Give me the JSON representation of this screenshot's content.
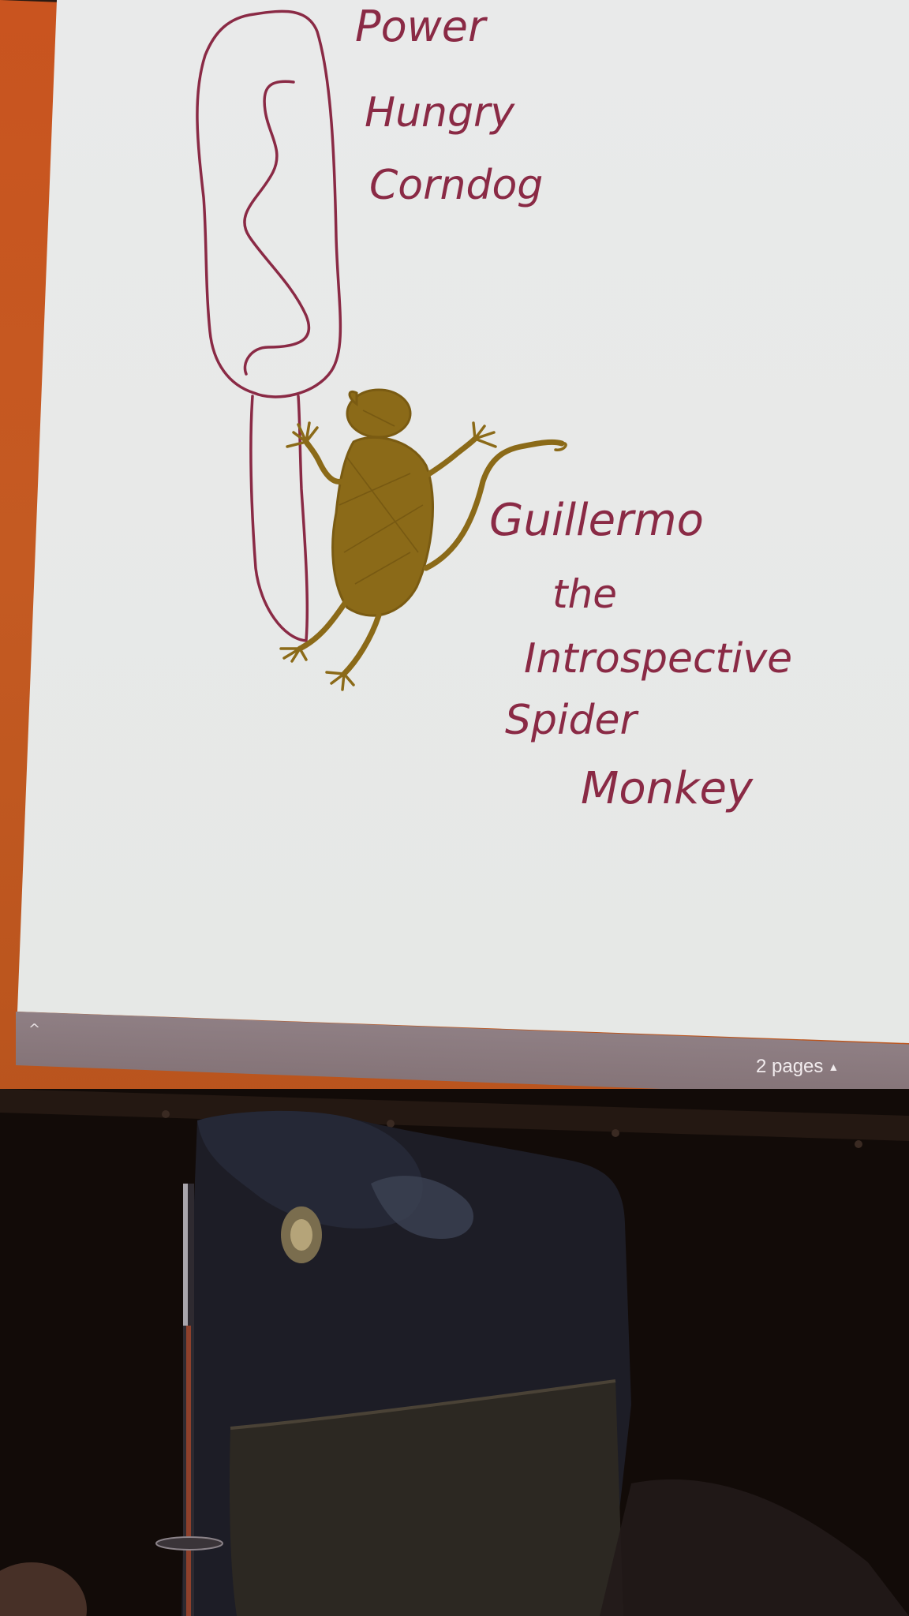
{
  "canvas": {
    "label_top_lines": [
      "Power",
      "Hungry",
      "Corndog"
    ],
    "label_bottom_lines": [
      "Guillermo",
      "the",
      "Introspective",
      "Spider",
      "Monkey"
    ]
  },
  "toolbar": {
    "collapse_glyph": "^",
    "pages_label": "2 pages",
    "pages_arrow": "▲"
  },
  "colors": {
    "ink_purple": "#8a2a45",
    "ink_brown": "#8b6a18",
    "screen_white": "#eceeec",
    "projection_orange": "#c9541f"
  },
  "icons": {
    "collapse": "chevron-up-icon",
    "pages_menu": "triangle-up-icon"
  }
}
